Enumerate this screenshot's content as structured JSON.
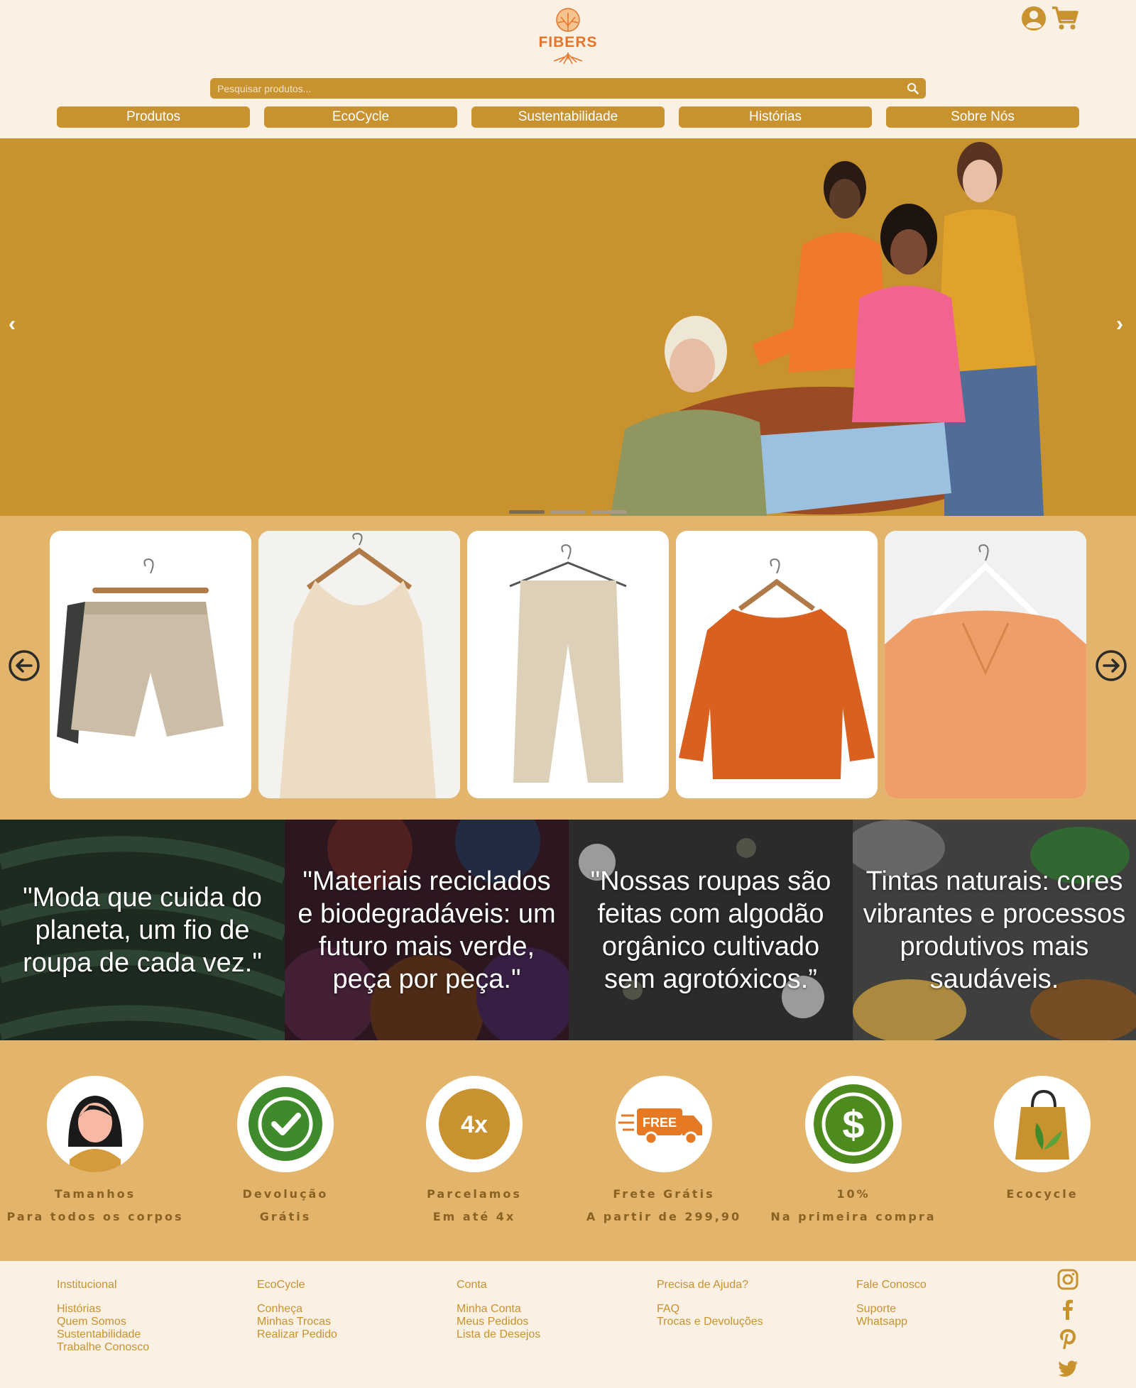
{
  "brand": {
    "name": "FIBERS",
    "logo_color": "#e6742a"
  },
  "header": {
    "account_icon": "user-circle-icon",
    "cart_icon": "shopping-cart-icon"
  },
  "search": {
    "placeholder": "Pesquisar produtos...",
    "icon": "search-icon"
  },
  "nav": {
    "items": [
      {
        "label": "Produtos"
      },
      {
        "label": "EcoCycle"
      },
      {
        "label": "Sustentabilidade"
      },
      {
        "label": "Histórias"
      },
      {
        "label": "Sobre Nós"
      }
    ]
  },
  "hero": {
    "prev_label": "‹",
    "next_label": "›",
    "slides": 3,
    "active_slide": 1,
    "photo": "four women in colorful sweaters sitting on a sofa"
  },
  "products": {
    "prev_icon": "arrow-left-circle-icon",
    "next_icon": "arrow-right-circle-icon",
    "items": [
      {
        "image": "linen drawstring shorts on hanger"
      },
      {
        "image": "cream pleated tank top on hanger"
      },
      {
        "image": "beige striped trousers on hanger"
      },
      {
        "image": "orange long-sleeve blouse on hanger"
      },
      {
        "image": "peach pleated v-neck blouse on hanger"
      }
    ]
  },
  "quotes": [
    {
      "text": "\"Moda que cuida do planeta, um fio de roupa de cada vez.\"",
      "background": "dark green leaves"
    },
    {
      "text": "\"Materiais reciclados e biodegradáveis: um futuro mais verde, peça por peça.\"",
      "background": "rolls of colorful fabric"
    },
    {
      "text": "\"Nossas roupas são feitas com algodão orgânico cultivado sem agrotóxicos.”",
      "background": "cotton flowers and eucalyptus"
    },
    {
      "text": "Tintas naturais: cores vibrantes e processos produtivos mais saudáveis.",
      "background": "open paint cans"
    }
  ],
  "benefits": [
    {
      "title": "Tamanhos",
      "subtitle": "Para todos os corpos",
      "icon": "woman-avatar-icon"
    },
    {
      "title": "Devolução",
      "subtitle": "Grátis",
      "icon": "check-badge-icon"
    },
    {
      "title": "Parcelamos",
      "subtitle": "Em até 4x",
      "icon": "installments-4x-icon"
    },
    {
      "title": "Frete Grátis",
      "subtitle": "A partir de 299,90",
      "icon": "free-shipping-truck-icon"
    },
    {
      "title": "10%",
      "subtitle": "Na primeira compra",
      "icon": "dollar-coin-icon"
    },
    {
      "title": "Ecocycle",
      "subtitle": "",
      "icon": "eco-shopping-bag-icon"
    }
  ],
  "footer": {
    "columns": [
      {
        "title": "Institucional",
        "links": [
          "Histórias",
          "Quem Somos",
          "Sustentabilidade",
          "Trabalhe Conosco"
        ]
      },
      {
        "title": "EcoCycle",
        "links": [
          "Conheça",
          "Minhas Trocas",
          "Realizar Pedido"
        ]
      },
      {
        "title": "Conta",
        "links": [
          "Minha Conta",
          "Meus Pedidos",
          "Lista de Desejos"
        ]
      },
      {
        "title": "Precisa de Ajuda?",
        "links": [
          "FAQ",
          "Trocas e Devoluções"
        ]
      },
      {
        "title": "Fale Conosco",
        "links": [
          "Suporte",
          "Whatsapp"
        ]
      }
    ],
    "social": [
      "instagram-icon",
      "facebook-icon",
      "pinterest-icon",
      "twitter-icon"
    ]
  },
  "colors": {
    "page_bg": "#fbf0e4",
    "accent": "#c8922e",
    "strip_bg": "#e3b46b",
    "benefit_text": "#8a6222",
    "logo_orange": "#e6742a"
  }
}
